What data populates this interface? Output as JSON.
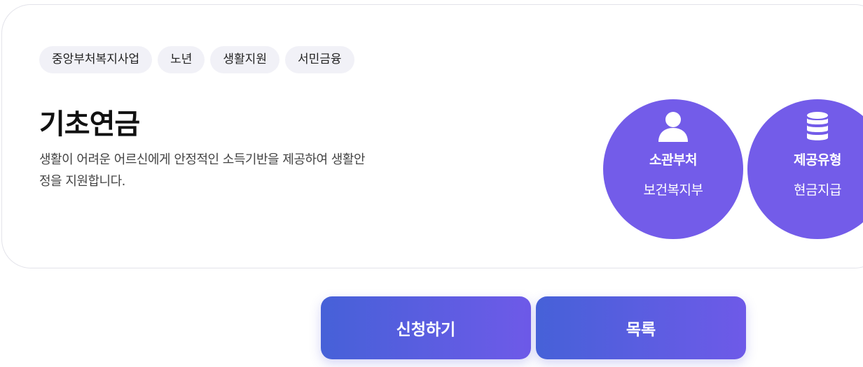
{
  "tags": [
    "중앙부처복지사업",
    "노년",
    "생활지원",
    "서민금융"
  ],
  "title": "기초연금",
  "description": "생활이 어려운 어르신에게 안정적인 소득기반을 제공하여 생활안정을 지원합니다.",
  "info": {
    "department": {
      "icon": "person-icon",
      "label": "소관부처",
      "value": "보건복지부"
    },
    "support_type": {
      "icon": "database-icon",
      "label": "제공유형",
      "value": "현금지급"
    }
  },
  "buttons": {
    "apply_label": "신청하기",
    "list_label": "목록"
  },
  "colors": {
    "accent": "#735ce9",
    "button_gradient_start": "#4661d8",
    "button_gradient_end": "#6e5ae8",
    "tag_background": "#f1f1f7"
  }
}
